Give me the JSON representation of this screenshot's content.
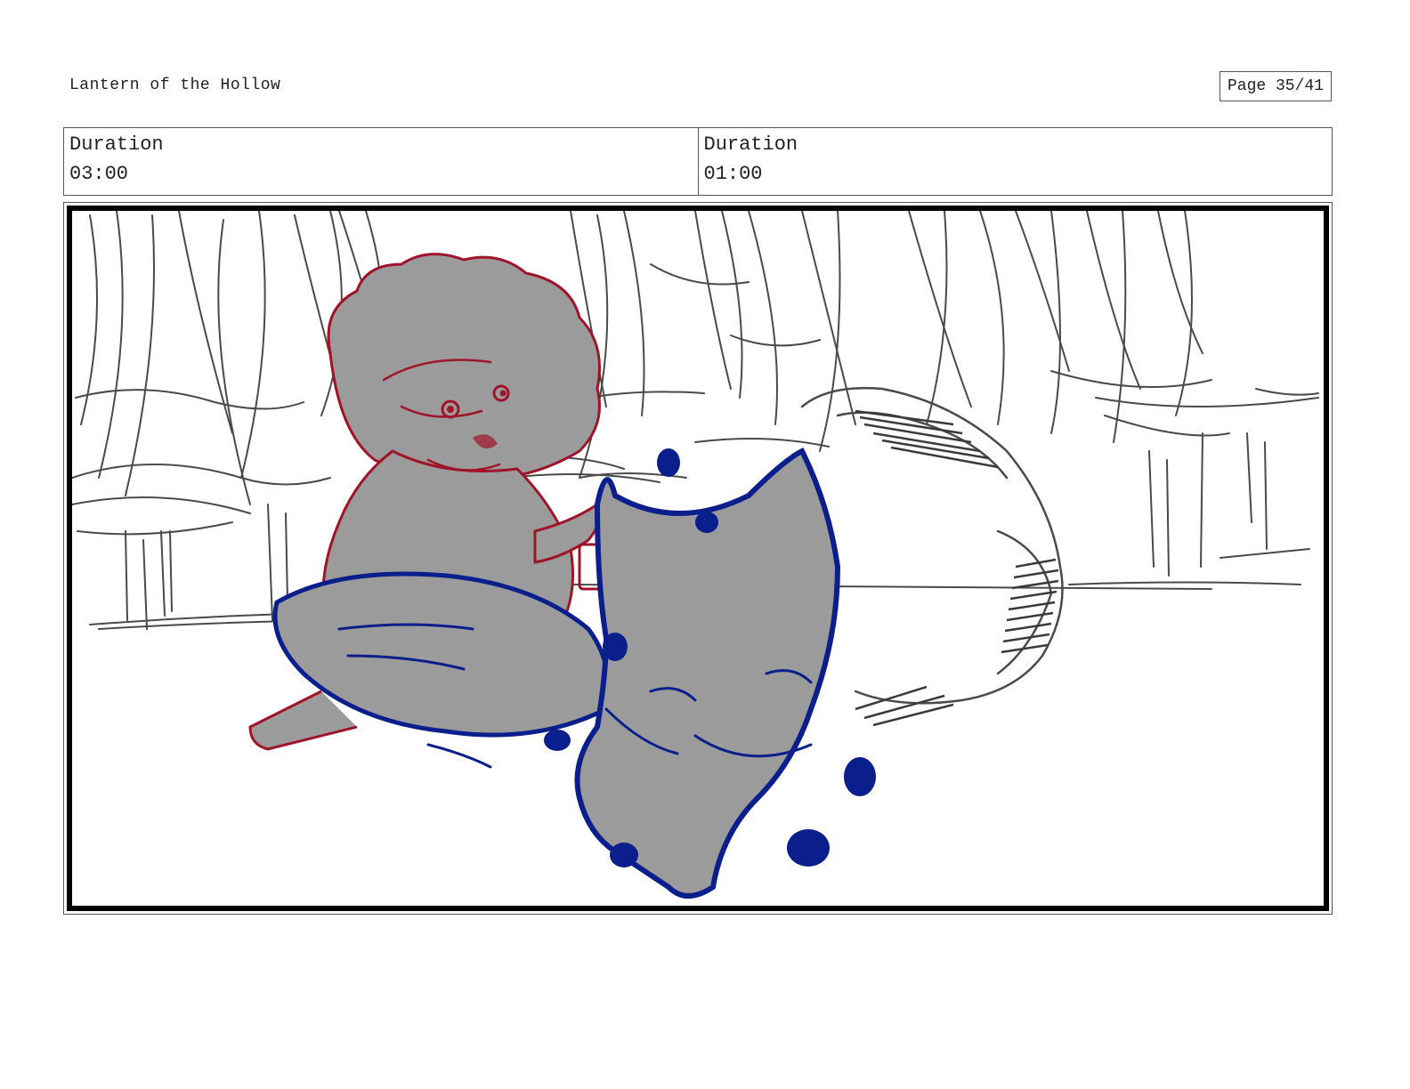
{
  "header": {
    "project_title": "Lantern of the Hollow",
    "page_label": "Page 35/41"
  },
  "durations": [
    {
      "label": "Duration",
      "value": "03:00"
    },
    {
      "label": "Duration",
      "value": "01:00"
    }
  ],
  "colors": {
    "pencil": "#4a4a4a",
    "girl_line": "#a0142a",
    "fox_line": "#0a1e8c",
    "fill": "#9b9b9b",
    "frame": "#000000"
  }
}
